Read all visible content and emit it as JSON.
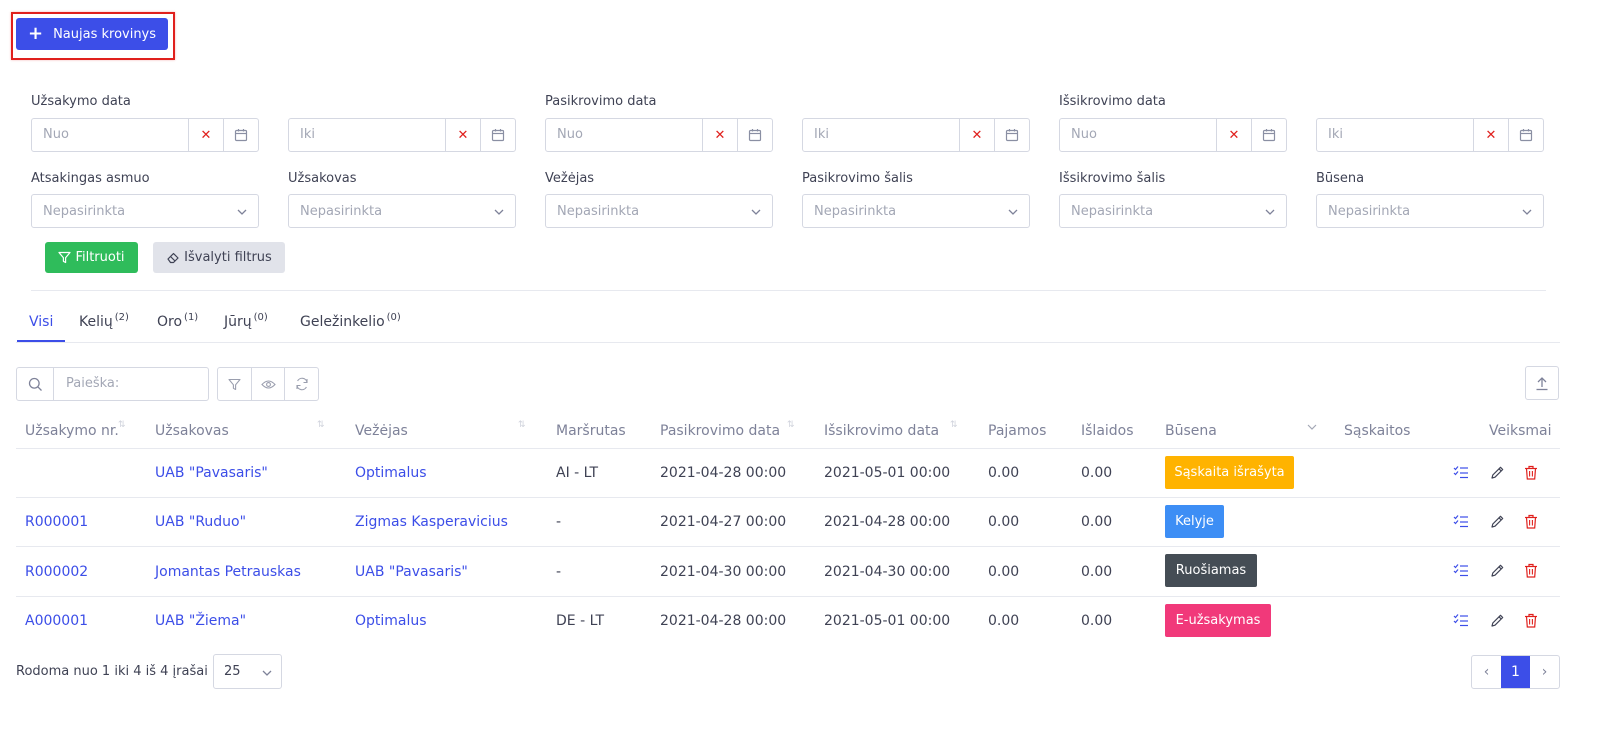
{
  "new_button": {
    "label": "Naujas krovinys"
  },
  "filters": {
    "order_date": {
      "label": "Užsakymo data",
      "from": "Nuo",
      "to": "Iki"
    },
    "loading_date": {
      "label": "Pasikrovimo data",
      "from": "Nuo",
      "to": "Iki"
    },
    "unloading_date": {
      "label": "Išsikrovimo data",
      "from": "Nuo",
      "to": "Iki"
    },
    "responsible": {
      "label": "Atsakingas asmuo",
      "value": "Nepasirinkta"
    },
    "customer": {
      "label": "Užsakovas",
      "value": "Nepasirinkta"
    },
    "carrier": {
      "label": "Vežėjas",
      "value": "Nepasirinkta"
    },
    "loading_country": {
      "label": "Pasikrovimo šalis",
      "value": "Nepasirinkta"
    },
    "unloading_country": {
      "label": "Išsikrovimo šalis",
      "value": "Nepasirinkta"
    },
    "status": {
      "label": "Būsena",
      "value": "Nepasirinkta"
    },
    "filter_button": "Filtruoti",
    "clear_button": "Išvalyti filtrus"
  },
  "tabs": [
    {
      "label": "Visi",
      "count": ""
    },
    {
      "label": "Kelių",
      "count": "(2)"
    },
    {
      "label": "Oro",
      "count": "(1)"
    },
    {
      "label": "Jūrų",
      "count": "(0)"
    },
    {
      "label": "Geležinkelio",
      "count": "(0)"
    }
  ],
  "search": {
    "placeholder": "Paieška:"
  },
  "columns": [
    "Užsakymo nr.",
    "Užsakovas",
    "Vežėjas",
    "Maršrutas",
    "Pasikrovimo data",
    "Išsikrovimo data",
    "Pajamos",
    "Išlaidos",
    "Būsena",
    "Sąskaitos",
    "Veiksmai"
  ],
  "rows": [
    {
      "order_no": "",
      "customer": "UAB \"Pavasaris\"",
      "carrier": "Optimalus",
      "route": "AI - LT",
      "loading": "2021-04-28 00:00",
      "unloading": "2021-05-01 00:00",
      "income": "0.00",
      "expenses": "0.00",
      "status": "Sąskaita išrašyta",
      "status_color": "#ffb300"
    },
    {
      "order_no": "R000001",
      "customer": "UAB \"Ruduo\"",
      "carrier": "Zigmas Kasperavicius",
      "route": "-",
      "loading": "2021-04-27 00:00",
      "unloading": "2021-04-28 00:00",
      "income": "0.00",
      "expenses": "0.00",
      "status": "Kelyje",
      "status_color": "#3d8ef5"
    },
    {
      "order_no": "R000002",
      "customer": "Jomantas Petrauskas",
      "carrier": "UAB \"Pavasaris\"",
      "route": "-",
      "loading": "2021-04-30 00:00",
      "unloading": "2021-04-30 00:00",
      "income": "0.00",
      "expenses": "0.00",
      "status": "Ruošiamas",
      "status_color": "#454d55"
    },
    {
      "order_no": "A000001",
      "customer": "UAB \"Žiema\"",
      "carrier": "Optimalus",
      "route": "DE - LT",
      "loading": "2021-04-28 00:00",
      "unloading": "2021-05-01 00:00",
      "income": "0.00",
      "expenses": "0.00",
      "status": "E-užsakymas",
      "status_color": "#f1397a"
    }
  ],
  "footer": {
    "showing": "Rodoma nuo 1 iki 4 iš 4 įrašai",
    "page_size": "25",
    "prev": "‹",
    "current_page": "1",
    "next": "›"
  }
}
